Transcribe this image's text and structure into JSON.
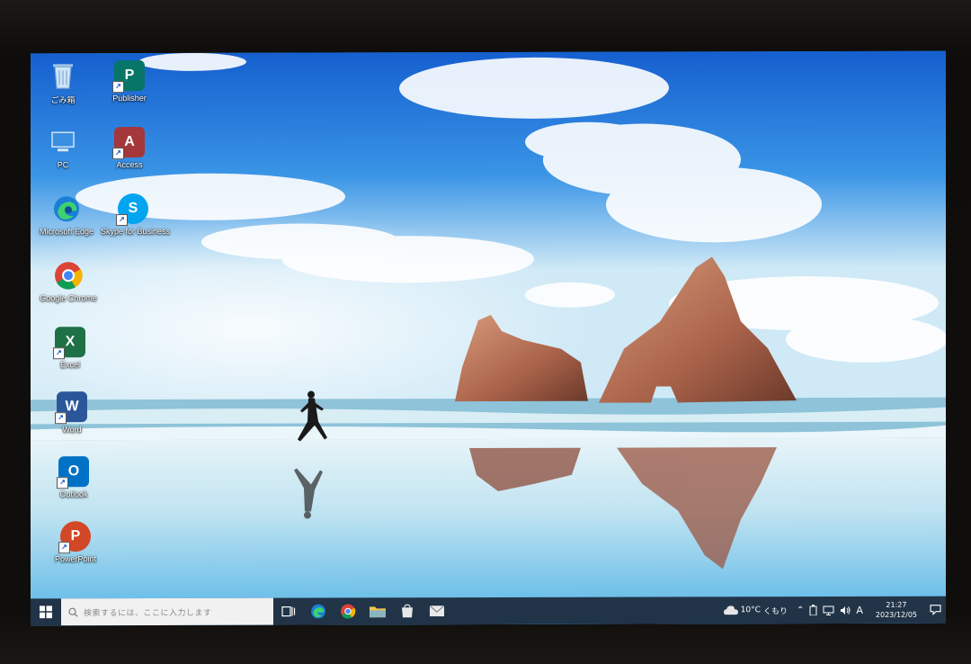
{
  "desktop": {
    "icons": [
      {
        "label": "ごみ箱",
        "icon": "recycle-bin-icon"
      },
      {
        "label": "Publisher",
        "icon": "publisher-icon",
        "color": "#077568"
      },
      {
        "label": "PC",
        "icon": "pc-icon"
      },
      {
        "label": "Access",
        "icon": "access-icon",
        "color": "#a4373a"
      },
      {
        "label": "Microsoft Edge",
        "icon": "edge-icon"
      },
      {
        "label": "Skype for Business",
        "icon": "skype-icon",
        "color": "#00a4ef"
      },
      {
        "label": "Google Chrome",
        "icon": "chrome-icon"
      },
      {
        "label": "Excel",
        "icon": "excel-icon",
        "color": "#1e7145"
      },
      {
        "label": "Word",
        "icon": "word-icon",
        "color": "#2b579a"
      },
      {
        "label": "Outlook",
        "icon": "outlook-icon",
        "color": "#0072c6"
      },
      {
        "label": "PowerPoint",
        "icon": "powerpoint-icon",
        "color": "#d24726"
      }
    ]
  },
  "taskbar": {
    "search_placeholder": "検索するには、ここに入力します",
    "pinned": [
      "task-view-icon",
      "edge-icon",
      "chrome-icon",
      "file-explorer-icon",
      "store-icon",
      "mail-icon"
    ],
    "weather": {
      "temp": "10°C",
      "condition": "くもり"
    },
    "ime": "A",
    "time": "21:27",
    "date": "2023/12/05"
  },
  "colors": {
    "taskbar_bg": "#1c283a",
    "sky_top": "#1b66d2",
    "sky_bottom": "#a9d6f2",
    "rock": "#b9765a"
  }
}
